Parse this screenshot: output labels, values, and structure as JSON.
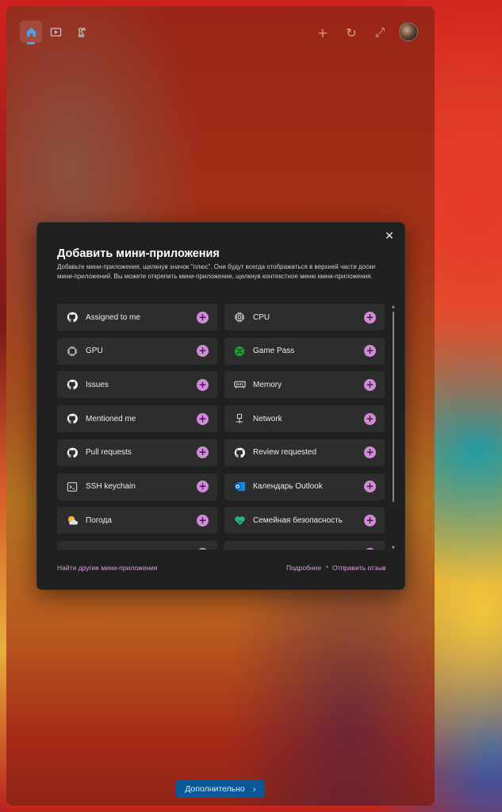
{
  "toolbar": {
    "nav": [
      {
        "name": "home-icon",
        "active": true
      },
      {
        "name": "play-icon",
        "active": false
      },
      {
        "name": "chess-icon",
        "active": false
      }
    ],
    "tools": [
      {
        "name": "add-icon",
        "glyph": "+"
      },
      {
        "name": "refresh-icon",
        "glyph": "↻"
      },
      {
        "name": "expand-icon",
        "glyph": "⤢"
      }
    ]
  },
  "dialog": {
    "title": "Добавить мини-приложения",
    "description": "Добавьте мини-приложения, щелкнув значок \"плюс\". Они будут всегда отображаться в верхней части доски мини-приложений. Вы можете открепить мини-приложение, щелкнув контекстное меню мини-приложения.",
    "close_glyph": "✕",
    "widgets": [
      {
        "label": "Assigned to me",
        "icon": "github-icon"
      },
      {
        "label": "CPU",
        "icon": "cpu-icon"
      },
      {
        "label": "GPU",
        "icon": "gpu-icon"
      },
      {
        "label": "Game Pass",
        "icon": "xbox-icon"
      },
      {
        "label": "Issues",
        "icon": "github-icon"
      },
      {
        "label": "Memory",
        "icon": "memory-icon"
      },
      {
        "label": "Mentioned me",
        "icon": "github-icon"
      },
      {
        "label": "Network",
        "icon": "network-icon"
      },
      {
        "label": "Pull requests",
        "icon": "github-icon"
      },
      {
        "label": "Review requested",
        "icon": "github-icon"
      },
      {
        "label": "SSH keychain",
        "icon": "terminal-icon"
      },
      {
        "label": "Календарь Outlook",
        "icon": "outlook-icon"
      },
      {
        "label": "Погода",
        "icon": "weather-icon"
      },
      {
        "label": "Семейная безопасность",
        "icon": "family-safety-icon"
      },
      {
        "label": "",
        "icon": "partial-icon"
      },
      {
        "label": "",
        "icon": "partial-icon"
      }
    ],
    "plus_glyph": "+",
    "footer": {
      "find_more": "Найти другие мини-приложения",
      "learn_more": "Подробнее",
      "separator": "•",
      "feedback": "Отправить отзыв"
    }
  },
  "more_button": {
    "label": "Дополнительно",
    "chevron": "›"
  }
}
